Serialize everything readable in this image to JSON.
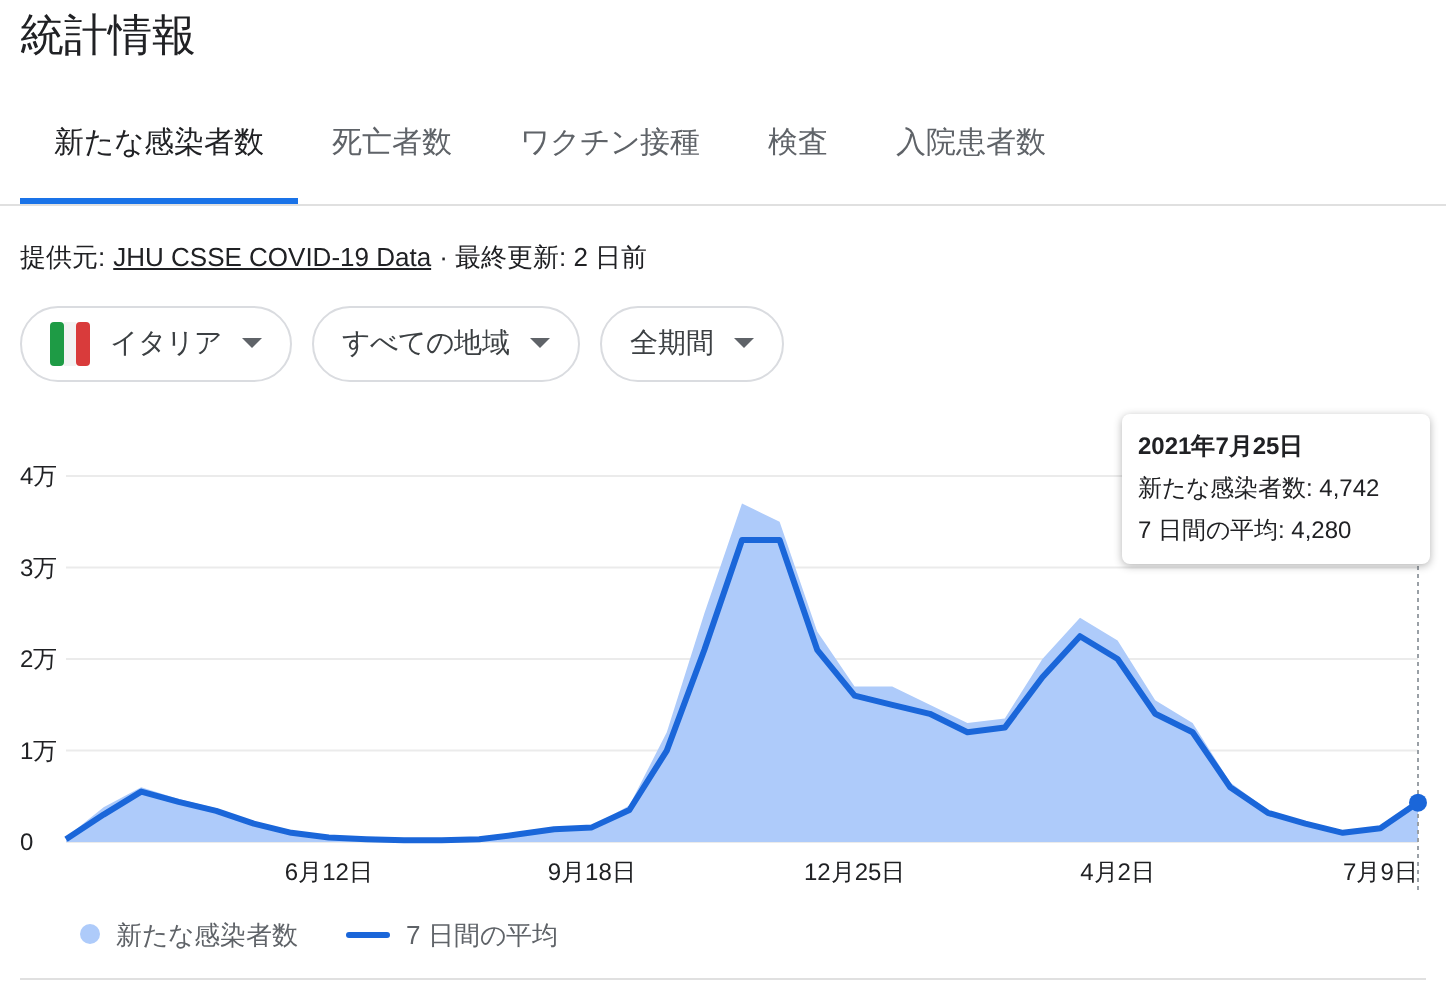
{
  "title": "統計情報",
  "tabs": [
    {
      "label": "新たな感染者数",
      "selected": true
    },
    {
      "label": "死亡者数",
      "selected": false
    },
    {
      "label": "ワクチン接種",
      "selected": false
    },
    {
      "label": "検査",
      "selected": false
    },
    {
      "label": "入院患者数",
      "selected": false
    }
  ],
  "source": {
    "prefix": "提供元:",
    "link": "JHU CSSE COVID-19 Data",
    "updated": "· 最終更新: 2 日前"
  },
  "filters": [
    {
      "label": "イタリア",
      "kind": "flag"
    },
    {
      "label": "すべての地域",
      "kind": "plain"
    },
    {
      "label": "全期間",
      "kind": "plain"
    }
  ],
  "chart": {
    "chart_data": {
      "type": "area",
      "categories": [
        null,
        null,
        null,
        null,
        null,
        null,
        null,
        "6月12日",
        null,
        null,
        null,
        null,
        null,
        null,
        "9月18日",
        null,
        null,
        null,
        null,
        null,
        null,
        "12月25日",
        null,
        null,
        null,
        null,
        null,
        null,
        "4月2日",
        null,
        null,
        null,
        null,
        null,
        null,
        "7月9日",
        null
      ],
      "series": [
        {
          "name": "新たな感染者数",
          "type": "area",
          "color": "#aecbfa",
          "values": [
            0.05,
            0.38,
            0.6,
            0.47,
            0.37,
            0.22,
            0.11,
            0.06,
            0.03,
            0.02,
            0.02,
            0.03,
            0.1,
            0.15,
            0.17,
            0.4,
            1.2,
            2.5,
            3.7,
            3.5,
            2.3,
            1.7,
            1.7,
            1.5,
            1.3,
            1.35,
            2.0,
            2.45,
            2.2,
            1.55,
            1.3,
            0.65,
            0.35,
            0.2,
            0.1,
            0.17,
            0.47
          ]
        },
        {
          "name": "7 日間の平均",
          "type": "line",
          "color": "#1a66d9",
          "values": [
            0.03,
            0.3,
            0.55,
            0.44,
            0.34,
            0.2,
            0.1,
            0.05,
            0.03,
            0.02,
            0.02,
            0.03,
            0.08,
            0.14,
            0.16,
            0.35,
            1.0,
            2.1,
            3.3,
            3.3,
            2.1,
            1.6,
            1.5,
            1.4,
            1.2,
            1.25,
            1.8,
            2.25,
            2.0,
            1.4,
            1.2,
            0.6,
            0.32,
            0.2,
            0.1,
            0.15,
            0.43
          ]
        }
      ],
      "ylim": [
        0,
        4
      ],
      "grid": true,
      "yticks": [
        {
          "value": 0,
          "label": "0"
        },
        {
          "value": 1,
          "label": "1万"
        },
        {
          "value": 2,
          "label": "2万"
        },
        {
          "value": 3,
          "label": "3万"
        },
        {
          "value": 4,
          "label": "4万"
        }
      ]
    },
    "tooltip": {
      "date": "2021年7月25日",
      "lines": [
        "新たな感染者数: 4,742",
        "7 日間の平均: 4,280"
      ]
    }
  }
}
